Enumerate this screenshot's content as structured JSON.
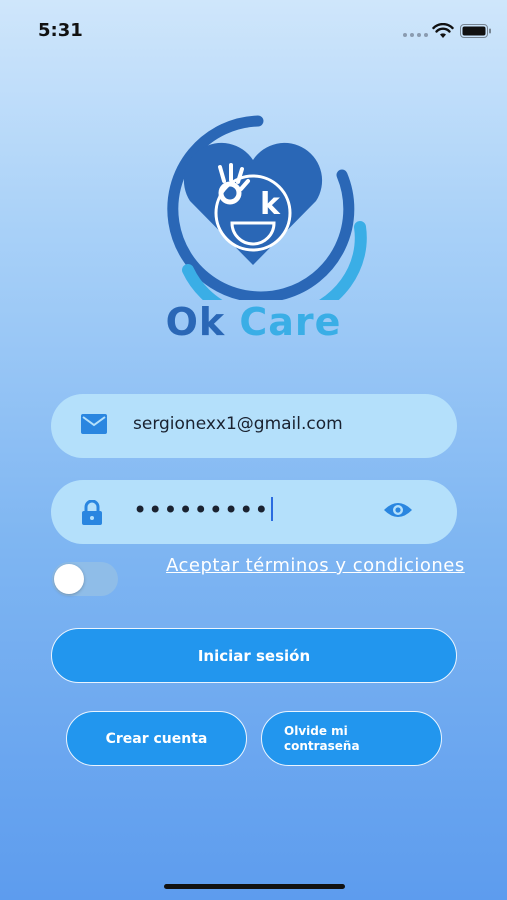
{
  "status_bar": {
    "time": "5:31"
  },
  "brand": {
    "word1": "Ok",
    "word2": "Care",
    "logo_letters": "k"
  },
  "login": {
    "email_value": "sergionexx1@gmail.com",
    "password_value": "•••••••••",
    "terms_text": "Aceptar términos y condiciones",
    "accept_terms_on": false,
    "login_button": "Iniciar sesión",
    "create_account_button": "Crear cuenta",
    "forgot_password_button": "Olvide mi contraseña"
  },
  "icons": [
    "mail-icon",
    "lock-icon",
    "eye-icon",
    "wifi-icon",
    "battery-icon",
    "signal-icon"
  ],
  "colors": {
    "primary": "#2296ee",
    "field_bg": "#b4e0fb",
    "brand_dark": "#2a67b6",
    "brand_light": "#3aaee6"
  }
}
